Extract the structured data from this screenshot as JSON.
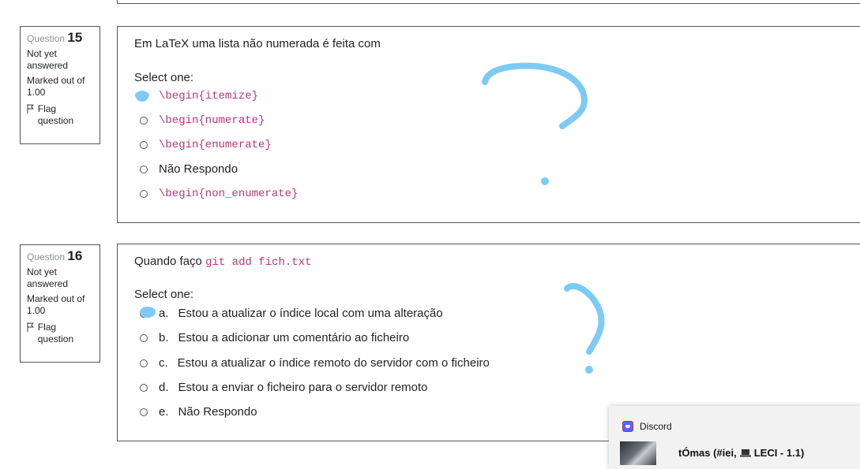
{
  "questions": [
    {
      "label": "Question",
      "number": "15",
      "state": "Not yet answered",
      "grade": "Marked out of 1.00",
      "flag_label": "Flag question",
      "text": "Em LaTeX uma lista não numerada é feita com",
      "prompt": "Select one:",
      "options": [
        {
          "letter": "",
          "text": "\\begin{itemize}",
          "code": true
        },
        {
          "letter": "",
          "text": "\\begin{numerate}",
          "code": true
        },
        {
          "letter": "",
          "text": "\\begin{enumerate}",
          "code": true
        },
        {
          "letter": "",
          "text": "Não Respondo",
          "code": false
        },
        {
          "letter": "",
          "text": "\\begin{non_enumerate}",
          "code": true
        }
      ]
    },
    {
      "label": "Question",
      "number": "16",
      "state": "Not yet answered",
      "grade": "Marked out of 1.00",
      "flag_label": "Flag question",
      "text_prefix": "Quando faço",
      "text_code": "git add fich.txt",
      "prompt": "Select one:",
      "options": [
        {
          "letter": "a.",
          "text": "Estou a atualizar o índice local com uma alteração"
        },
        {
          "letter": "b.",
          "text": "Estou a adicionar um comentário ao ficheiro"
        },
        {
          "letter": "c.",
          "text": "Estou a atualizar o índice remoto do servidor com o ficheiro"
        },
        {
          "letter": "d.",
          "text": "Estou a enviar o ficheiro para o servidor remoto"
        },
        {
          "letter": "e.",
          "text": "Não Respondo"
        }
      ]
    }
  ],
  "notification": {
    "app_name": "Discord",
    "title_prefix": "tÓmas (#iei,",
    "title_suffix": "LECI - 1.1)"
  },
  "colors": {
    "annotation": "#7dcbf5",
    "code": "#c0347a",
    "discord": "#5865f2"
  },
  "icons": [
    "flag-icon",
    "discord-icon",
    "laptop-icon"
  ]
}
